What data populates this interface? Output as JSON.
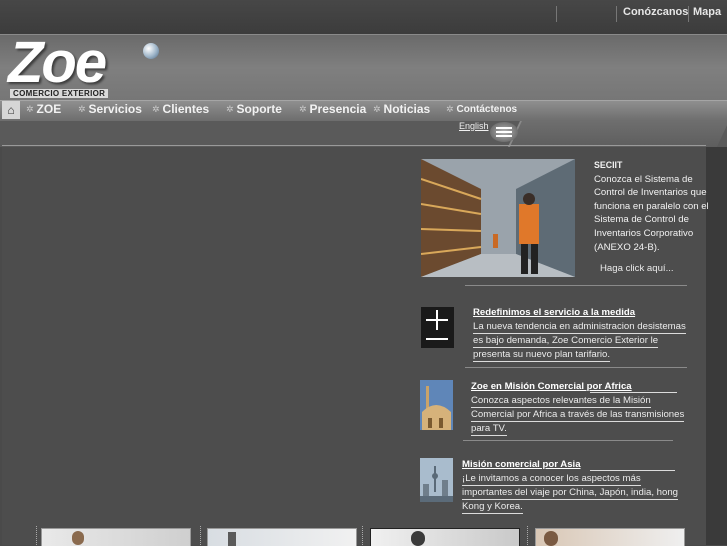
{
  "topnav": {
    "link1": "Conózcanos",
    "link2": "Mapa"
  },
  "logo": {
    "word": "Zoe",
    "sub": "COMERCIO EXTERIOR"
  },
  "nav": [
    {
      "label": "ZOE"
    },
    {
      "label": "Servicios"
    },
    {
      "label": "Clientes"
    },
    {
      "label": "Soporte"
    },
    {
      "label": "Presencia"
    },
    {
      "label": "Noticias"
    },
    {
      "label": "Contáctenos"
    }
  ],
  "language": {
    "link": "English"
  },
  "promo": {
    "heading": "SECIIT",
    "lines": [
      "Conozca el Sistema de",
      "Control de Inventarios que",
      "funciona en paralelo con el",
      "Sistema de Control de",
      "Inventarios Corporativo",
      "(ANEXO 24-B)."
    ],
    "more": "Haga click aquí..."
  },
  "news": [
    {
      "title": "Redefinimos el servicio a la medida",
      "lines": [
        "La nueva tendencia en administracion desistemas",
        "es bajo demanda, Zoe Comercio Exterior le",
        "presenta su nuevo plan tarifario."
      ]
    },
    {
      "title": "Zoe en Misión Comercial por Africa",
      "lines": [
        "Conozca aspectos relevantes de la Misión",
        "Comercial por Africa a través de las transmisiones",
        "para TV."
      ]
    },
    {
      "title": "Misión comercial por Asia",
      "lines": [
        "¡Le invitamos a conocer los aspectos más",
        "importantes del viaje por China, Japón, india, hong",
        "Kong y Korea."
      ]
    }
  ],
  "colors": {
    "background": "#4a4a4a",
    "header": "#7a7a7a",
    "text": "#f2f2f2"
  }
}
